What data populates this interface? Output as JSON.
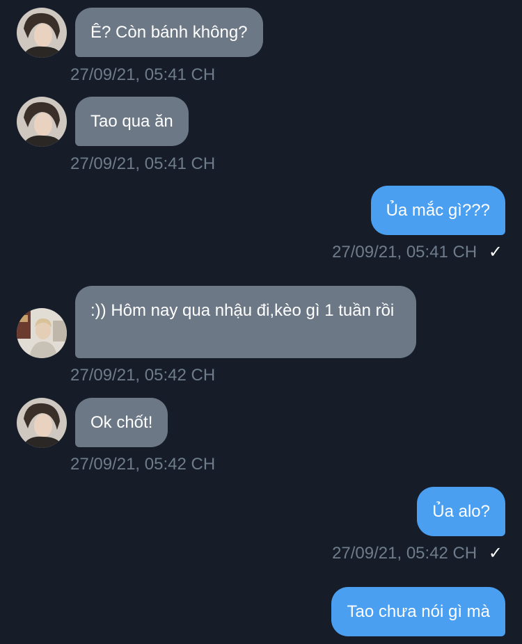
{
  "conversation": {
    "messages": [
      {
        "side": "in",
        "sender": "friend-1",
        "text": "Ê? Còn bánh không?",
        "time": "27/09/21, 05:41 CH"
      },
      {
        "side": "in",
        "sender": "friend-1",
        "text": "Tao qua ăn",
        "time": "27/09/21, 05:41 CH"
      },
      {
        "side": "out",
        "text": "Ủa mắc gì???",
        "time": "27/09/21, 05:41 CH",
        "status": "✓"
      },
      {
        "side": "in",
        "sender": "friend-2",
        "text": ":)) Hôm nay qua nhậu đi,kèo gì 1 tuần rồi",
        "time": "27/09/21, 05:42 CH"
      },
      {
        "side": "in",
        "sender": "friend-1",
        "text": "Ok chốt!",
        "time": "27/09/21, 05:42 CH"
      },
      {
        "side": "out",
        "text": "Ủa alo?",
        "time": "27/09/21, 05:42 CH",
        "status": "✓"
      },
      {
        "side": "out",
        "text": "Tao chưa nói gì mà",
        "time": "",
        "status": ""
      }
    ]
  },
  "colors": {
    "background": "#161d29",
    "incoming_bubble": "#6c7886",
    "outgoing_bubble": "#4b9ff0",
    "timestamp": "#6f7c8b"
  }
}
